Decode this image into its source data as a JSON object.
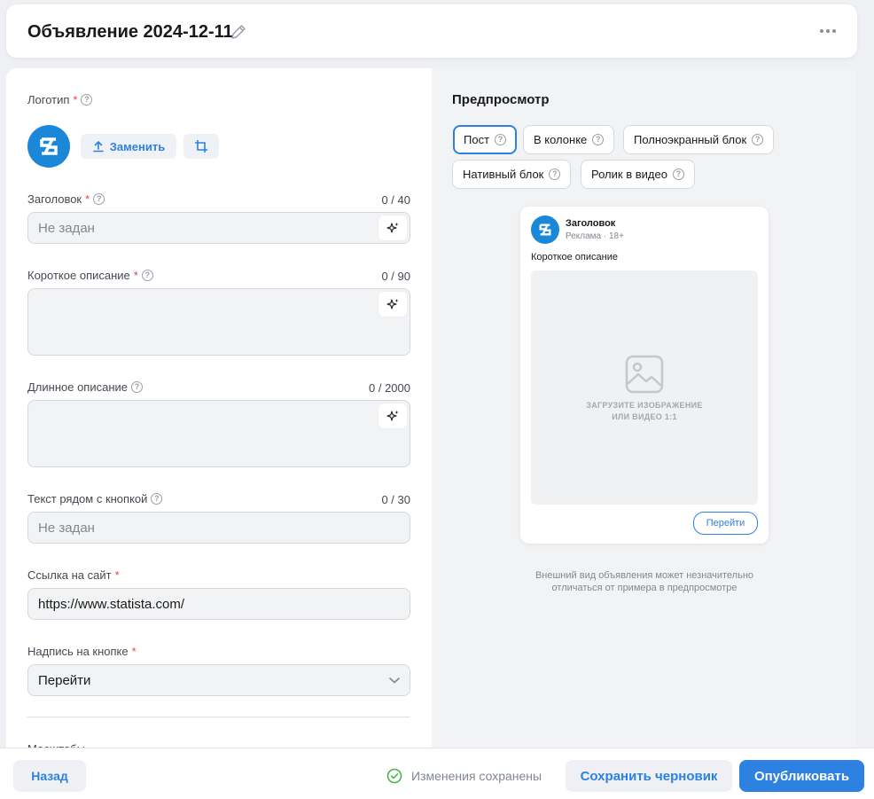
{
  "header": {
    "title": "Объявление 2024-12-11"
  },
  "form": {
    "logo": {
      "label": "Логотип",
      "replace_label": "Заменить"
    },
    "title": {
      "label": "Заголовок",
      "counter": "0 / 40",
      "placeholder": "Не задан"
    },
    "short_desc": {
      "label": "Короткое описание",
      "counter": "0 / 90"
    },
    "long_desc": {
      "label": "Длинное описание",
      "counter": "0 / 2000"
    },
    "button_text": {
      "label": "Текст рядом с кнопкой",
      "counter": "0 / 30",
      "placeholder": "Не задан"
    },
    "site_link": {
      "label": "Ссылка на сайт",
      "value": "https://www.statista.com/"
    },
    "button_caption": {
      "label": "Надпись на кнопке",
      "value": "Перейти"
    },
    "next_section_label": "Масштабы"
  },
  "preview": {
    "title": "Предпросмотр",
    "tabs": [
      "Пост",
      "В колонке",
      "Полноэкранный блок",
      "Нативный блок",
      "Ролик в видео"
    ],
    "ad": {
      "headline": "Заголовок",
      "sub": "Реклама · 18+",
      "description": "Короткое описание",
      "image_line1": "ЗАГРУЗИТЕ ИЗОБРАЖЕНИЕ",
      "image_line2": "ИЛИ ВИДЕО 1:1",
      "button": "Перейти"
    },
    "note_line1": "Внешний вид объявления может незначительно",
    "note_line2": "отличаться от примера в предпросмотре"
  },
  "footer": {
    "back": "Назад",
    "saved": "Изменения сохранены",
    "save_draft": "Сохранить черновик",
    "publish": "Опубликовать"
  },
  "colors": {
    "accent": "#2d81e0",
    "logo_bg": "#1a87d9",
    "required": "#e64646",
    "success": "#4bb34b"
  },
  "required_mark": "*",
  "help_mark": "?"
}
